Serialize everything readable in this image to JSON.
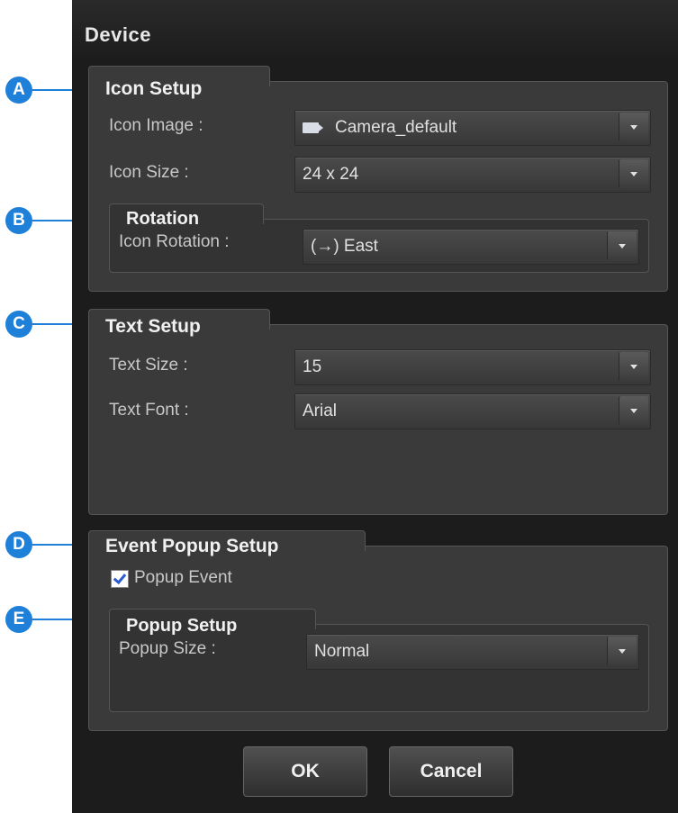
{
  "dialog": {
    "title": "Device"
  },
  "callouts": [
    "A",
    "B",
    "C",
    "D",
    "E"
  ],
  "accent_color": "#1e80d8",
  "icon_setup": {
    "title": "Icon Setup",
    "icon_image_label": "Icon Image :",
    "icon_image_value": "Camera_default",
    "icon_image_icon": "camera-icon",
    "icon_size_label": "Icon Size :",
    "icon_size_value": "24 x 24"
  },
  "rotation": {
    "title": "Rotation",
    "icon_rotation_label": "Icon Rotation :",
    "icon_rotation_value": "(→) East"
  },
  "text_setup": {
    "title": "Text Setup",
    "text_size_label": "Text Size :",
    "text_size_value": "15",
    "text_font_label": "Text Font :",
    "text_font_value": "Arial"
  },
  "event_popup_setup": {
    "title": "Event Popup Setup",
    "popup_event_label": "Popup Event",
    "popup_event_checked": true
  },
  "popup_setup": {
    "title": "Popup Setup",
    "popup_size_label": "Popup Size :",
    "popup_size_value": "Normal"
  },
  "buttons": {
    "ok": "OK",
    "cancel": "Cancel"
  }
}
